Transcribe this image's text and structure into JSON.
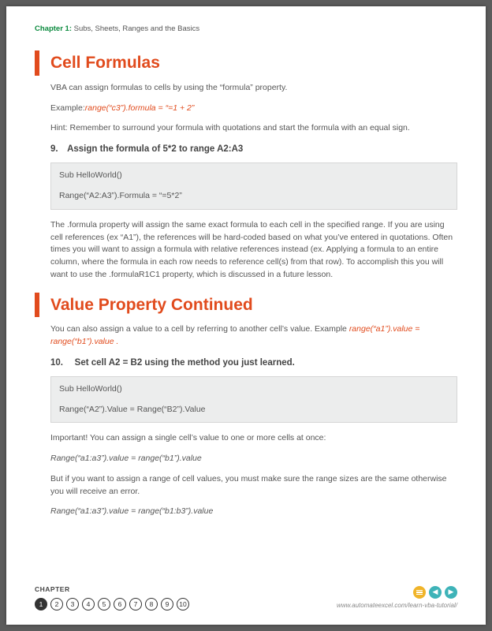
{
  "header": {
    "label": "Chapter 1:",
    "title": "Subs, Sheets, Ranges and the Basics"
  },
  "s1": {
    "heading": "Cell Formulas",
    "p1a": "VBA can assign formulas to cells by using the “formula” property.",
    "ex_label": "Example:",
    "ex_code": "range(“c3”).formula = “=1 + 2”",
    "hint": "Hint: Remember to surround your formula with quotations and start the formula with an equal sign.",
    "sub": "9. Assign the formula of 5*2 to range A2:A3",
    "code_l1": "Sub HelloWorld()",
    "code_l2": "Range(“A2:A3”).Formula = “=5*2”",
    "explain": "The .formula property will assign the same exact formula to each cell in the specified range. If you are using cell references (ex “A1”), the references will be hard-coded based on what you’ve entered in quotations. Often times you will want to assign a formula with relative references instead (ex. Applying a formula to an entire column, where the formula in each row needs to reference cell(s) from that row). To accomplish this you will want to use the .formulaR1C1 property, which is discussed in a future lesson."
  },
  "s2": {
    "heading": "Value Property Continued",
    "p1a": "You can also assign a value to a cell by referring to another cell’s value. Example ",
    "p1code": "range(“a1”).value = range(“b1”).value .",
    "sub": "10.  Set cell A2 = B2 using the method you just learned.",
    "code_l1": "Sub HelloWorld()",
    "code_l2": "Range(“A2”).Value = Range(“B2”).Value",
    "p2": "Important! You can assign a single cell’s value to one or more cells at once:",
    "red1": "Range(“a1:a3”).value = range(“b1”).value",
    "p3": "But if you want to assign a range of cell values, you must make sure the range sizes are the same otherwise you will receive an error.",
    "red2": "Range(“a1:a3”).value = range(“b1:b3”).value"
  },
  "footer": {
    "label": "CHAPTER",
    "pages": [
      "1",
      "2",
      "3",
      "4",
      "5",
      "6",
      "7",
      "8",
      "9",
      "10"
    ],
    "url": "www.automateexcel.com/learn-vba-tutorial/"
  }
}
